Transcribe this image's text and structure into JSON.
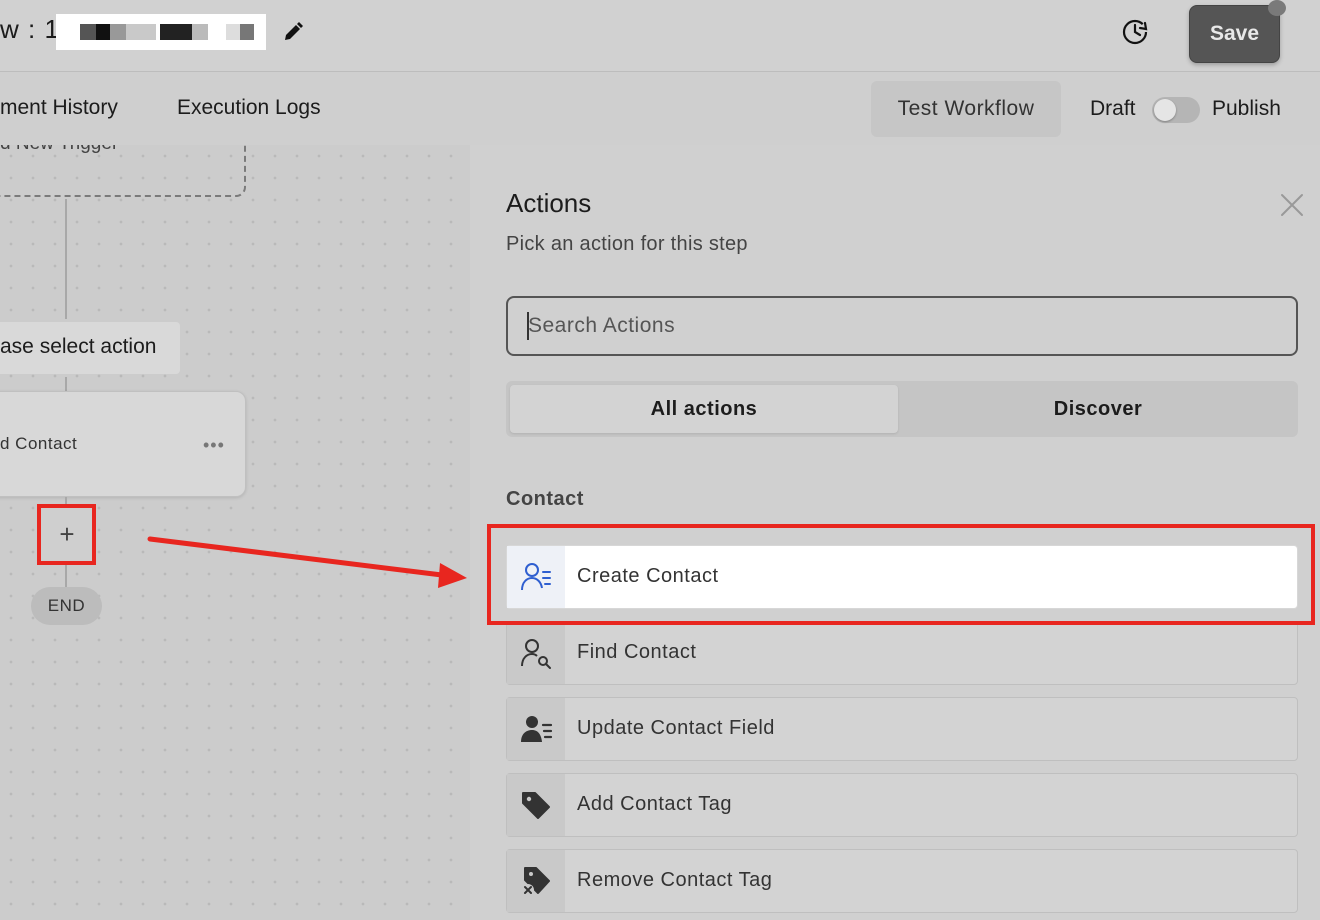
{
  "header": {
    "workflow_prefix": "w : 1",
    "save_label": "Save"
  },
  "tabs": {
    "history_label": "ment History",
    "logs_label": "Execution Logs",
    "test_label": "Test Workflow",
    "draft_label": "Draft",
    "publish_label": "Publish",
    "publish_on": false
  },
  "canvas": {
    "trigger_text": "d New Trigger",
    "select_action_text": "ase select action",
    "node_text": "d Contact",
    "node_menu": "•••",
    "add_symbol": "+",
    "end_label": "END"
  },
  "panel": {
    "title": "Actions",
    "subtitle": "Pick an action for this step",
    "search_placeholder": "Search Actions",
    "segments": [
      "All actions",
      "Discover"
    ],
    "section_label": "Contact",
    "actions": [
      {
        "label": "Create Contact",
        "icon": "person-list-icon"
      },
      {
        "label": "Find Contact",
        "icon": "person-search-icon"
      },
      {
        "label": "Update Contact Field",
        "icon": "person-edit-icon"
      },
      {
        "label": "Add Contact Tag",
        "icon": "tag-icon"
      },
      {
        "label": "Remove Contact Tag",
        "icon": "tag-remove-icon"
      }
    ]
  },
  "colors": {
    "highlight": "#e8261f",
    "accent_blue": "#2f5fd0"
  }
}
